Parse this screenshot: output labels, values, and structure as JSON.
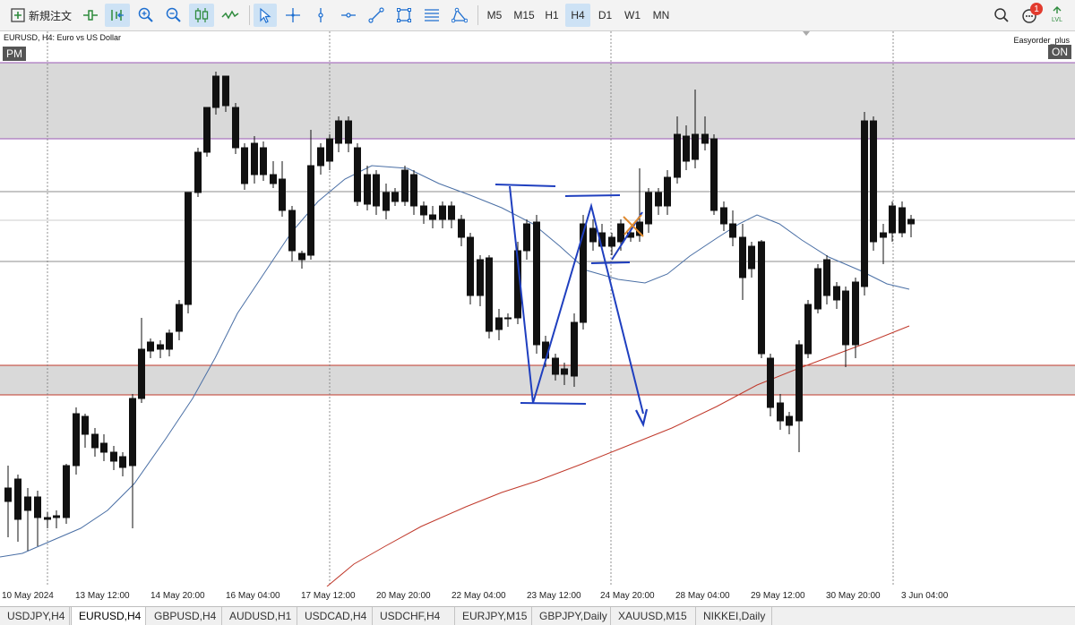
{
  "toolbar": {
    "new_order_label": "新規注文",
    "timeframes": [
      "M5",
      "M15",
      "H1",
      "H4",
      "D1",
      "W1",
      "MN"
    ],
    "active_timeframe": "H4",
    "notification_count": "1"
  },
  "chart": {
    "symbol_info": "EURUSD, H4:  Euro vs US Dollar",
    "pm_label": "PM",
    "on_label": "ON",
    "expert_label": "Easyorder_plus",
    "x_labels": [
      "10 May 2024",
      "13 May 12:00",
      "14 May 20:00",
      "16 May 04:00",
      "17 May 12:00",
      "20 May 20:00",
      "22 May 04:00",
      "23 May 12:00",
      "24 May 20:00",
      "28 May 04:00",
      "29 May 12:00",
      "30 May 20:00",
      "3 Jun 04:00"
    ]
  },
  "tabs": [
    "USDJPY,H4",
    "EURUSD,H4",
    "GBPUSD,H4",
    "AUDUSD,H1",
    "USDCAD,H4",
    "USDCHF,H4",
    "EURJPY,M15",
    "GBPJPY,Daily",
    "XAUUSD,M15",
    "NIKKEI,Daily"
  ],
  "active_tab": "EURUSD,H4",
  "colors": {
    "zone_fill": "#d9d9d9",
    "upper_zone_border": "#9b59b6",
    "lower_zone_border": "#c0392b",
    "ma_short": "#4a6fa5",
    "ma_long": "#c0392b",
    "drawing": "#1f3fbf",
    "selected": "#cde2f5"
  }
}
